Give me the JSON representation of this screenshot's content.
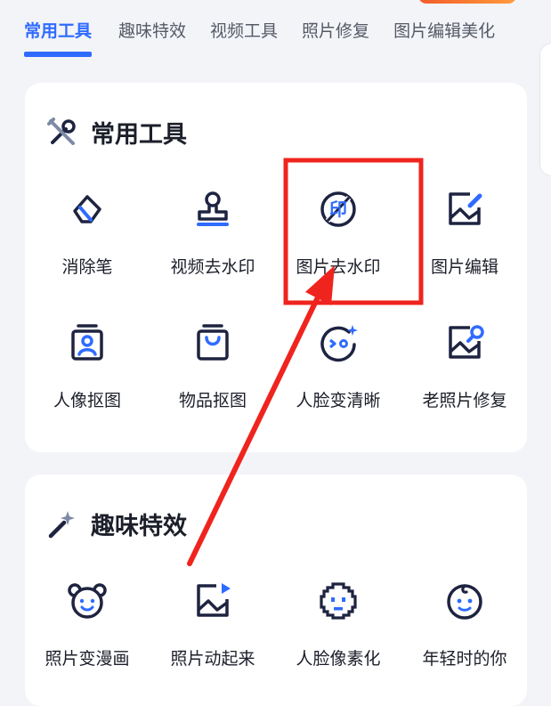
{
  "tabs": [
    {
      "label": "常用工具",
      "active": true
    },
    {
      "label": "趣味特效",
      "active": false
    },
    {
      "label": "视频工具",
      "active": false
    },
    {
      "label": "照片修复",
      "active": false
    },
    {
      "label": "图片编辑美化",
      "active": false
    }
  ],
  "section_common": {
    "title": "常用工具",
    "items": [
      {
        "label": "消除笔",
        "icon": "eraser-icon"
      },
      {
        "label": "视频去水印",
        "icon": "stamp-icon"
      },
      {
        "label": "图片去水印",
        "icon": "print-seal-icon"
      },
      {
        "label": "图片编辑",
        "icon": "image-edit-icon"
      },
      {
        "label": "人像抠图",
        "icon": "portrait-cutout-icon"
      },
      {
        "label": "物品抠图",
        "icon": "bag-cutout-icon"
      },
      {
        "label": "人脸变清晰",
        "icon": "face-enhance-icon"
      },
      {
        "label": "老照片修复",
        "icon": "photo-repair-icon"
      }
    ]
  },
  "section_fun": {
    "title": "趣味特效",
    "items": [
      {
        "label": "照片变漫画",
        "icon": "cartoon-bear-icon"
      },
      {
        "label": "照片动起来",
        "icon": "photo-play-icon"
      },
      {
        "label": "人脸像素化",
        "icon": "pixel-face-icon"
      },
      {
        "label": "年轻时的你",
        "icon": "baby-face-icon"
      }
    ]
  },
  "colors": {
    "accent": "#2f6bff",
    "icon_stroke": "#1e2340",
    "annotation": "#f0241e"
  },
  "icon_seal_char": "印"
}
